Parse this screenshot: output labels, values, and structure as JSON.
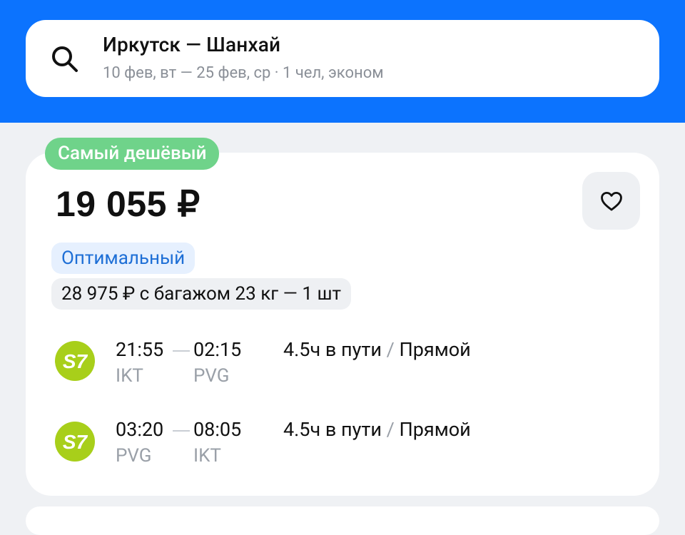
{
  "search": {
    "title": "Иркутск — Шанхай",
    "subtitle": "10 фев, вт — 25 фев, ср · 1 чел, эконом",
    "icon": "search-icon"
  },
  "offer": {
    "badge": "Самый дешёвый",
    "price": "19 055 ₽",
    "tag": "Оптимальный",
    "baggage_option": "28 975 ₽ с багажом 23 кг — 1 шт",
    "favorite_icon": "heart-icon"
  },
  "segments": [
    {
      "airline": "S7",
      "dep_time": "21:55",
      "arr_time": "02:15",
      "dep_code": "IKT",
      "arr_code": "PVG",
      "duration": "4.5ч в пути",
      "separator": "/",
      "type": "Прямой"
    },
    {
      "airline": "S7",
      "dep_time": "03:20",
      "arr_time": "08:05",
      "dep_code": "PVG",
      "arr_code": "IKT",
      "duration": "4.5ч в пути",
      "separator": "/",
      "type": "Прямой"
    }
  ],
  "colors": {
    "brand_blue": "#0c73fe",
    "badge_green": "#6fd38a",
    "s7_green": "#a8cf1a",
    "tag_blue": "#1e6fd6"
  }
}
